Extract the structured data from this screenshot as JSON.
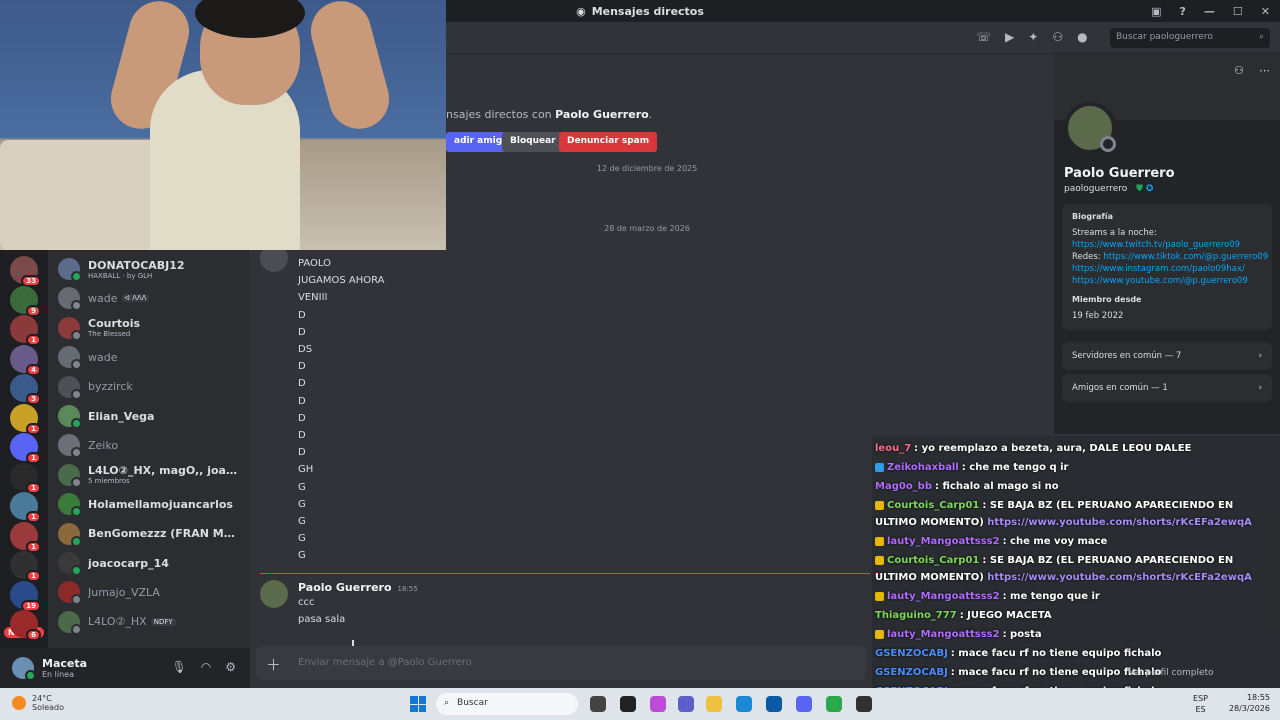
{
  "window": {
    "title": "Mensajes directos"
  },
  "header": {
    "search_placeholder": "Buscar paologuerrero"
  },
  "intro": {
    "prefix": "nsajes directos con ",
    "name": "Paolo Guerrero",
    "suffix": ".",
    "add_friend": "adir amigo",
    "block": "Bloquear",
    "report": "Denunciar spam"
  },
  "dividers": {
    "date1": "12 de diciembre de 2025",
    "date2": "28 de marzo de 2026"
  },
  "messages_block1": [
    "PAOLO",
    "JUGAMOS AHORA",
    "VENIII",
    "D",
    "D",
    "DS",
    "D",
    "D",
    "D",
    "D",
    "D",
    "D",
    "GH",
    "G",
    "G",
    "G",
    "G",
    "G"
  ],
  "message2": {
    "author": "Paolo Guerrero",
    "time": "18:55",
    "lines": [
      "ccc",
      "pasa sala"
    ]
  },
  "composer": {
    "placeholder": "Enviar mensaje a @Paolo Guerrero"
  },
  "dm_list": [
    {
      "name": "DONATOCABJ12",
      "sub": "HAXBALL · by GLH",
      "online": true,
      "color": "#5b6b8c"
    },
    {
      "name": "wade",
      "sub": "",
      "tag": "ᐊ ᐱᐱᐱ",
      "online": false,
      "dim": true,
      "color": "#666a72"
    },
    {
      "name": "Courtois",
      "sub": "The Blessed",
      "online": false,
      "color": "#8c3a3a"
    },
    {
      "name": "wade",
      "sub": "",
      "online": false,
      "dim": true,
      "color": "#666a72"
    },
    {
      "name": "byzzirck",
      "sub": "",
      "online": false,
      "dim": true,
      "color": "#4e5058"
    },
    {
      "name": "Elian_Vega",
      "sub": "",
      "online": true,
      "color": "#5a8a5a"
    },
    {
      "name": "Zeiko",
      "sub": "",
      "online": false,
      "dim": true,
      "color": "#6d6f78"
    },
    {
      "name": "L4LO②_HX, magO,, joacocarp...",
      "sub": "5 miembros",
      "online": false,
      "color": "#4a6a4a"
    },
    {
      "name": "Holamellamojuancarlos",
      "sub": "",
      "online": true,
      "color": "#3a7a3a"
    },
    {
      "name": "BenGomezzz (FRAN ME DIO D...",
      "sub": "",
      "online": true,
      "color": "#8a6a3a"
    },
    {
      "name": "joacocarp_14",
      "sub": "",
      "online": true,
      "color": "#3a3a3a"
    },
    {
      "name": "Jumajo_VZLA",
      "sub": "",
      "online": false,
      "dim": true,
      "color": "#8c2a2a"
    },
    {
      "name": "L4LO②_HX",
      "sub": "",
      "tag": "NDFY",
      "online": false,
      "dim": true,
      "color": "#4a6a4a"
    }
  ],
  "servers": [
    {
      "badge": "33",
      "color": "#7a4a4a"
    },
    {
      "badge": "9",
      "color": "#3a6a3a"
    },
    {
      "badge": "1",
      "color": "#8a3a3a"
    },
    {
      "badge": "4",
      "color": "#6a5a8a"
    },
    {
      "badge": "3",
      "color": "#3a5a8a"
    },
    {
      "badge": "1",
      "color": "#c8a028"
    },
    {
      "badge": "1",
      "color": "#5865f2"
    },
    {
      "badge": "1",
      "color": "#2a2a2a"
    },
    {
      "badge": "1",
      "color": "#4a7a9a"
    },
    {
      "badge": "1",
      "color": "#9a3a3a"
    },
    {
      "badge": "1",
      "color": "#303030"
    },
    {
      "badge": "19",
      "color": "#2a4a8a"
    },
    {
      "badge": "6",
      "color": "#9a2a2a"
    }
  ],
  "server_new": "NUEVO",
  "user_panel": {
    "name": "Maceta",
    "status": "En línea"
  },
  "profile": {
    "name": "Paolo Guerrero",
    "username": "paologuerrero",
    "bio_heading": "Biografía",
    "bio_line1": "Streams a la noche:",
    "bio_link1": "https://www.twitch.tv/paolo_guerrero09",
    "bio_line2_prefix": "Redes: ",
    "bio_link2": "https://www.tiktok.com/@p.guerrero09",
    "bio_link3": "https://www.instagram.com/paolo09hax/",
    "bio_link4": "https://www.youtube.com/@p.guerrero09",
    "member_heading": "Miembro desde",
    "member_date": "19 feb 2022",
    "servers_common": "Servidores en común — 7",
    "friends_common": "Amigos en común — 1",
    "view_full": "Ver perfil completo"
  },
  "twitch_chat": [
    {
      "user": "leou_7",
      "color": "#ff6b8a",
      "badge": "",
      "text": ": yo reemplazo a bezeta, aura, DALE LEOU DALEE",
      "link": ""
    },
    {
      "user": "Zeikohaxball",
      "color": "#b06bff",
      "badge": "blue",
      "text": ": che me tengo q ir",
      "link": ""
    },
    {
      "user": "Mag0o_bb",
      "color": "#b06bff",
      "badge": "",
      "text": ": fichalo al mago si no",
      "link": ""
    },
    {
      "user": "Courtois_Carp01",
      "color": "#7ed957",
      "badge": "gold",
      "text": ": SE BAJA BZ (EL PERUANO APARECIENDO EN ULTIMO MOMENTO)",
      "link": "https://www.youtube.com/shorts/rKcEFa2ewqA"
    },
    {
      "user": "lauty_Mangoattsss2",
      "color": "#b06bff",
      "badge": "gold",
      "text": ": che me voy mace",
      "link": ""
    },
    {
      "user": "Courtois_Carp01",
      "color": "#7ed957",
      "badge": "gold",
      "text": ": SE BAJA BZ (EL PERUANO APARECIENDO EN ULTIMO MOMENTO)",
      "link": "https://www.youtube.com/shorts/rKcEFa2ewqA"
    },
    {
      "user": "lauty_Mangoattsss2",
      "color": "#b06bff",
      "badge": "gold",
      "text": ": me tengo que ir",
      "link": ""
    },
    {
      "user": "Thiaguino_777",
      "color": "#7ed957",
      "badge": "",
      "text": ": JUEGO MACETA",
      "link": ""
    },
    {
      "user": "lauty_Mangoattsss2",
      "color": "#b06bff",
      "badge": "gold",
      "text": ": posta",
      "link": ""
    },
    {
      "user": "GSENZOCABJ",
      "color": "#4a8cff",
      "badge": "",
      "text": ": mace facu rf no tiene equipo fichalo",
      "link": ""
    },
    {
      "user": "GSENZOCABJ",
      "color": "#4a8cff",
      "badge": "",
      "text": ": mace facu rf no tiene equipo fichalo",
      "link": ""
    },
    {
      "user": "GSENZOCABJ",
      "color": "#4a8cff",
      "badge": "",
      "text": ": mace facu rf no tiene equipo fichalo",
      "link": ""
    },
    {
      "user": "GSENZOCABJ",
      "color": "#4a8cff",
      "badge": "",
      "text": ": mace facu rf no tiene equipo fichalo",
      "link": ""
    }
  ],
  "taskbar": {
    "temp": "24°C",
    "weather": "Soleado",
    "search": "Buscar",
    "lang1": "ESP",
    "lang2": "ES",
    "time": "18:55",
    "date": "28/3/2026"
  },
  "colors": {
    "accent": "#5865f2",
    "danger": "#da373c",
    "link": "#00a8fc"
  }
}
